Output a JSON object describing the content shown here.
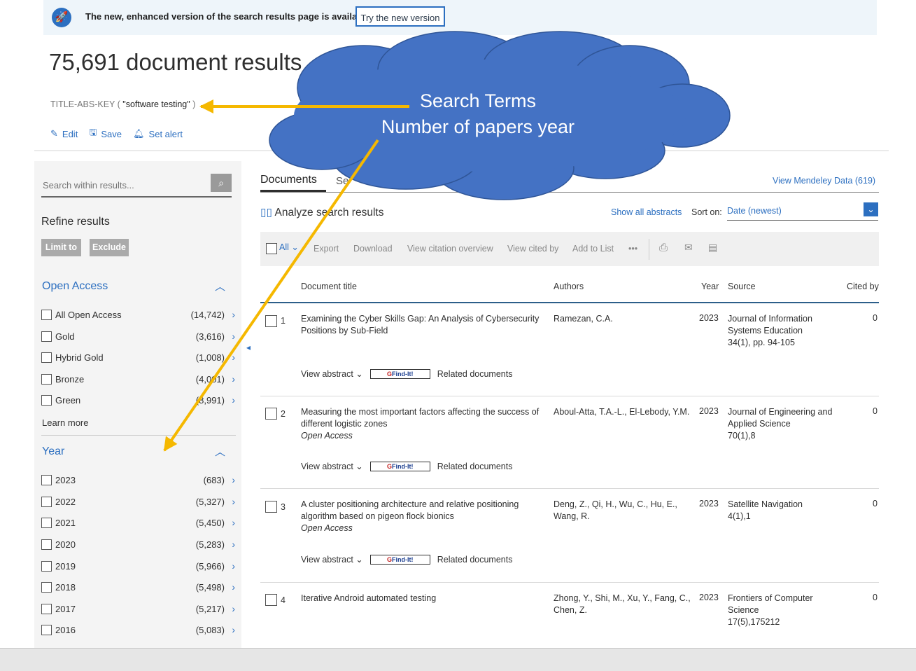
{
  "banner": {
    "text": "The new, enhanced version of the search results page is available.",
    "button": "Try the new version"
  },
  "header": {
    "results_title": "75,691 document results",
    "query_prefix": "TITLE-ABS-KEY (",
    "query_term": "\"software testing\"",
    "query_suffix": ")",
    "actions": {
      "edit": "Edit",
      "save": "Save",
      "set_alert": "Set alert"
    }
  },
  "sidebar": {
    "search_placeholder": "Search within results...",
    "refine_title": "Refine results",
    "limit_to": "Limit to",
    "exclude": "Exclude",
    "open_access": {
      "title": "Open Access",
      "items": [
        {
          "label": "All Open Access",
          "count": "(14,742)"
        },
        {
          "label": "Gold",
          "count": "(3,616)"
        },
        {
          "label": "Hybrid Gold",
          "count": "(1,008)"
        },
        {
          "label": "Bronze",
          "count": "(4,001)"
        },
        {
          "label": "Green",
          "count": "(8,991)"
        }
      ],
      "learn_more": "Learn more"
    },
    "year": {
      "title": "Year",
      "items": [
        {
          "label": "2023",
          "count": "(683)"
        },
        {
          "label": "2022",
          "count": "(5,327)"
        },
        {
          "label": "2021",
          "count": "(5,450)"
        },
        {
          "label": "2020",
          "count": "(5,283)"
        },
        {
          "label": "2019",
          "count": "(5,966)"
        },
        {
          "label": "2018",
          "count": "(5,498)"
        },
        {
          "label": "2017",
          "count": "(5,217)"
        },
        {
          "label": "2016",
          "count": "(5,083)"
        }
      ]
    }
  },
  "main": {
    "tab_documents": "Documents",
    "tab_second": "Se",
    "mendeley": "View Mendeley Data (619)",
    "analyze": "Analyze search results",
    "show_abstracts": "Show all abstracts",
    "sort_label": "Sort on:",
    "sort_value": "Date (newest)",
    "toolbar": {
      "all": "All",
      "export": "Export",
      "download": "Download",
      "citation_overview": "View citation overview",
      "cited_by": "View cited by",
      "add_to_list": "Add to List",
      "more": "•••"
    },
    "columns": {
      "title": "Document title",
      "authors": "Authors",
      "year": "Year",
      "source": "Source",
      "cited_by": "Cited by"
    },
    "rows": [
      {
        "num": "1",
        "title": "Examining the Cyber Skills Gap: An Analysis of Cybersecurity Positions by Sub-Field",
        "open_access": "",
        "authors": "Ramezan, C.A.",
        "year": "2023",
        "source_name": "Journal of Information Systems Education",
        "source_detail": "34(1), pp. 94-105",
        "cited": "0"
      },
      {
        "num": "2",
        "title": "Measuring the most important factors affecting the success of different logistic zones",
        "open_access": "Open Access",
        "authors": "Aboul-Atta, T.A.-L., El-Lebody, Y.M.",
        "year": "2023",
        "source_name": "Journal of Engineering and Applied Science",
        "source_detail": "70(1),8",
        "cited": "0"
      },
      {
        "num": "3",
        "title": "A cluster positioning architecture and relative positioning algorithm based on pigeon flock bionics",
        "open_access": "Open Access",
        "authors": "Deng, Z., Qi, H., Wu, C., Hu, E., Wang, R.",
        "year": "2023",
        "source_name": "Satellite Navigation",
        "source_detail": "4(1),1",
        "cited": "0"
      },
      {
        "num": "4",
        "title": "Iterative Android automated testing",
        "open_access": "",
        "authors": "Zhong, Y., Shi, M., Xu, Y., Fang, C., Chen, Z.",
        "year": "2023",
        "source_name": "Frontiers of Computer Science",
        "source_detail": "17(5),175212",
        "cited": "0"
      }
    ],
    "row_links": {
      "view_abstract": "View abstract",
      "findit_prefix": "G",
      "findit": "Find-It!",
      "related": "Related documents"
    }
  },
  "annotation": {
    "line1": "Search Terms",
    "line2": "Number of papers year",
    "cloud_color": "#4472c4",
    "arrow_color": "#f5b800"
  }
}
